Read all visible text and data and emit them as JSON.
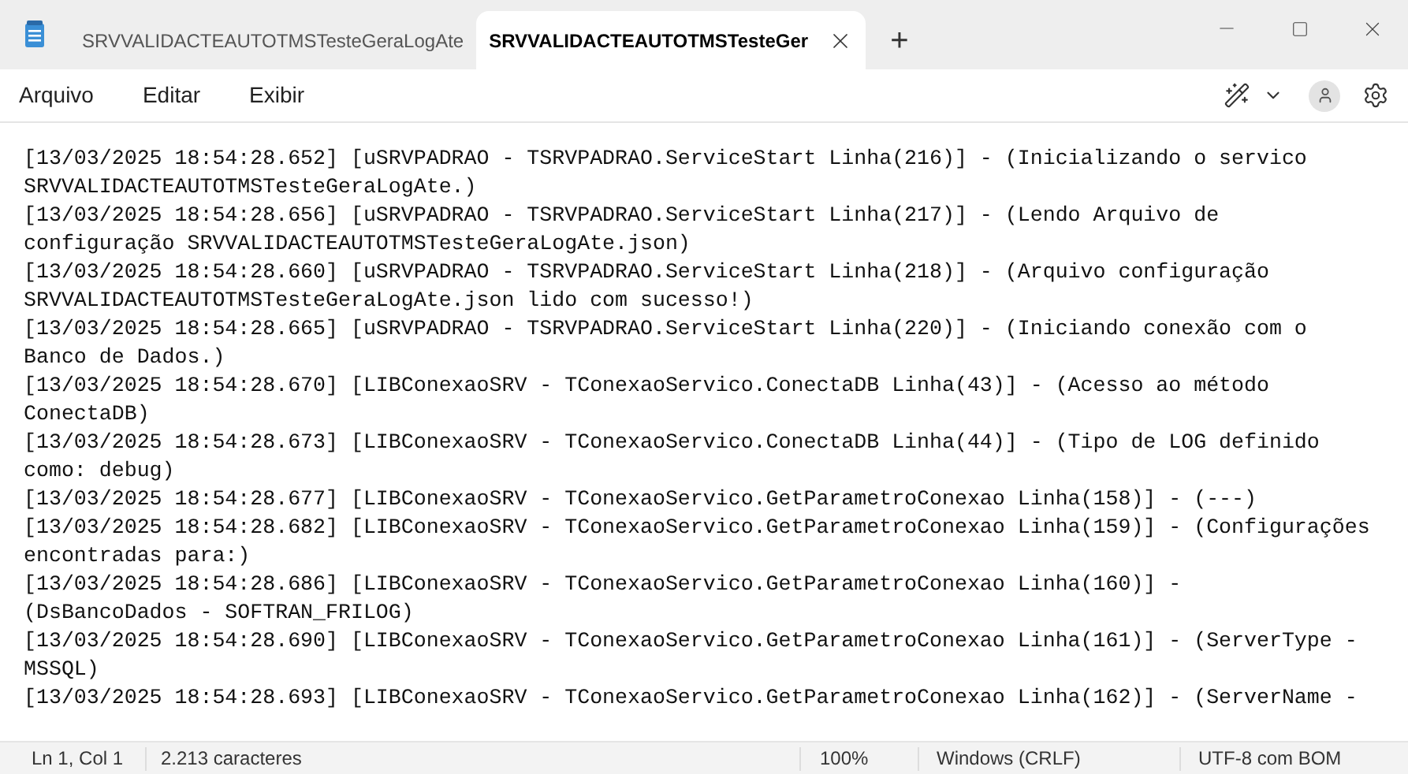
{
  "tabs": [
    {
      "label": "SRVVALIDACTEAUTOTMSTesteGeraLogAte",
      "selected": false
    },
    {
      "label": "SRVVALIDACTEAUTOTMSTesteGer",
      "selected": true
    }
  ],
  "new_tab": "+",
  "menu": [
    "Arquivo",
    "Editar",
    "Exibir"
  ],
  "document_lines": [
    [
      "[13/03/2025 18:54:28.652] [uSRVPADRAO - TSRVPADRAO.ServiceStart Linha(216)] - (Inicializando o servico",
      "SRVVALIDACTEAUTOTMSTesteGeraLogAte.)"
    ],
    [
      "[13/03/2025 18:54:28.656] [uSRVPADRAO - TSRVPADRAO.ServiceStart Linha(217)] - (Lendo Arquivo de",
      "configuração SRVVALIDACTEAUTOTMSTesteGeraLogAte.json)"
    ],
    [
      "[13/03/2025 18:54:28.660] [uSRVPADRAO - TSRVPADRAO.ServiceStart Linha(218)] - (Arquivo configuração",
      "SRVVALIDACTEAUTOTMSTesteGeraLogAte.json lido com sucesso!)"
    ],
    [
      "[13/03/2025 18:54:28.665] [uSRVPADRAO - TSRVPADRAO.ServiceStart Linha(220)] - (Iniciando conexão com o",
      "Banco de Dados.)"
    ],
    [
      "[13/03/2025 18:54:28.670] [LIBConexaoSRV - TConexaoServico.ConectaDB Linha(43)] - (Acesso ao método",
      "ConectaDB)"
    ],
    [
      "[13/03/2025 18:54:28.673] [LIBConexaoSRV - TConexaoServico.ConectaDB Linha(44)] - (Tipo de LOG definido",
      "como: debug)"
    ],
    [
      "[13/03/2025 18:54:28.677] [LIBConexaoSRV - TConexaoServico.GetParametroConexao Linha(158)] - (---)"
    ],
    [
      "[13/03/2025 18:54:28.682] [LIBConexaoSRV - TConexaoServico.GetParametroConexao Linha(159)] - (Configurações",
      "encontradas para:)"
    ],
    [
      "[13/03/2025 18:54:28.686] [LIBConexaoSRV - TConexaoServico.GetParametroConexao Linha(160)] -",
      "(DsBancoDados - SOFTRAN_FRILOG)"
    ],
    [
      "[13/03/2025 18:54:28.690] [LIBConexaoSRV - TConexaoServico.GetParametroConexao Linha(161)] - (ServerType -",
      "MSSQL)"
    ],
    [
      "[13/03/2025 18:54:28.693] [LIBConexaoSRV - TConexaoServico.GetParametroConexao Linha(162)] - (ServerName -"
    ]
  ],
  "status_bar": {
    "position": "Ln 1, Col 1",
    "characters": "2.213 caracteres",
    "zoom": "100%",
    "line_ending": "Windows (CRLF)",
    "encoding": "UTF-8 com BOM"
  }
}
